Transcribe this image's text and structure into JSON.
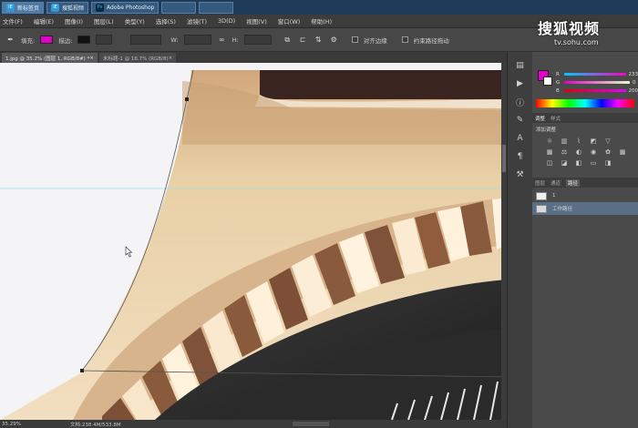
{
  "taskbar": {
    "tabs": [
      {
        "icon": "IE",
        "label": "新标签页"
      },
      {
        "icon": "IE",
        "label": "搜狐视频"
      },
      {
        "icon": "Ps",
        "label": "Adobe Photoshop"
      },
      {
        "icon": "",
        "label": ""
      },
      {
        "icon": "",
        "label": ""
      }
    ]
  },
  "menu": [
    "文件(F)",
    "编辑(E)",
    "图像(I)",
    "图层(L)",
    "类型(Y)",
    "选择(S)",
    "滤镜(T)",
    "3D(D)",
    "视图(V)",
    "窗口(W)",
    "帮助(H)"
  ],
  "options": {
    "fill_label": "填充:",
    "stroke_label": "描边:",
    "fill_color": "#e000c8",
    "stroke_color": "#111111",
    "align_edges_label": "对齐边缘",
    "rubber_band_label": "约束路径拖动"
  },
  "doc_tabs": [
    {
      "label": "1.jpg @ 35.2% (图层 1, RGB/8#) *"
    },
    {
      "label": "未标题-1 @ 16.7% (RGB/8)"
    }
  ],
  "status": {
    "zoom": "35.29%",
    "doc_size": "文档:238.4M/533.8M"
  },
  "color_panel": {
    "fg_color": "#e000c8",
    "r_value": "233",
    "g_value": "0",
    "b_value": "200"
  },
  "adjustments": {
    "tabs": [
      "调整",
      "样式"
    ],
    "title": "添加调整",
    "icons": [
      "sun-icon",
      "curves-icon",
      "levels-icon",
      "exposure-icon",
      "triangle-icon",
      "vibrance-icon",
      "hue-icon",
      "balance-icon",
      "bw-icon",
      "camera-icon",
      "mixer-icon",
      "grid-icon",
      "invert-icon",
      "posterize-icon",
      "threshold-icon",
      "gradient-map-icon",
      "selective-color-icon",
      "shadow-icon"
    ]
  },
  "layers_panel": {
    "tabs": [
      "图层",
      "通道",
      "路径"
    ],
    "active_tab": "路径",
    "paths": [
      {
        "label": "1",
        "selected": false
      },
      {
        "label": "工作路径",
        "selected": true
      }
    ]
  },
  "watermark": {
    "brand": "搜狐视频",
    "url": "tv.sohu.com"
  }
}
